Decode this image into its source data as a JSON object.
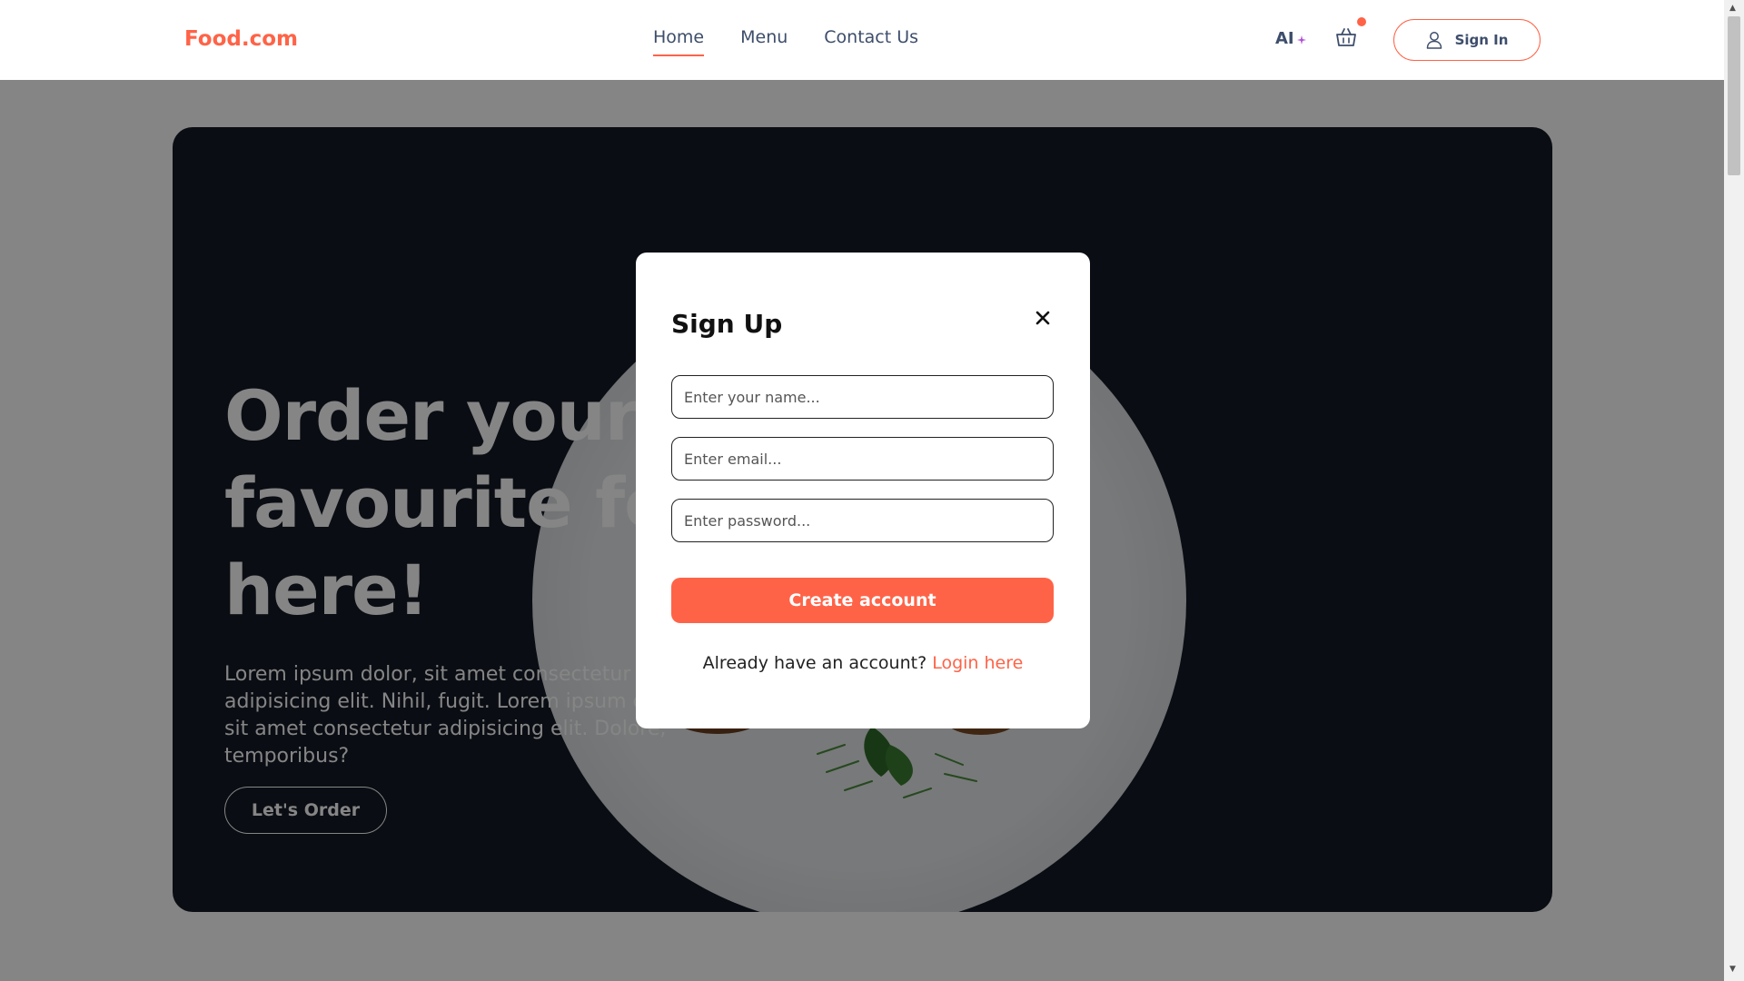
{
  "header": {
    "logo": "Food.com",
    "nav": [
      {
        "label": "Home",
        "active": true
      },
      {
        "label": "Menu",
        "active": false
      },
      {
        "label": "Contact Us",
        "active": false
      }
    ],
    "ai_label": "AI",
    "cart_icon": "basket-icon",
    "signin_label": "Sign In",
    "user_icon": "user-icon"
  },
  "hero": {
    "title": "Order your favourite food here!",
    "text": "Lorem ipsum dolor, sit amet consectetur adipisicing elit. Nihil, fugit. Lorem ipsum dolor, sit amet consectetur adipisicing elit. Dolore, temporibus?",
    "cta": "Let's Order"
  },
  "modal": {
    "title": "Sign Up",
    "close_icon": "close-icon",
    "name_placeholder": "Enter your name...",
    "email_placeholder": "Enter email...",
    "password_placeholder": "Enter password...",
    "submit_label": "Create account",
    "login_prompt": "Already have an account?",
    "login_link": "Login here"
  },
  "colors": {
    "accent": "#ff6347",
    "nav_text": "#3d4d6b",
    "hero_bg": "#141a26",
    "overlay": "rgba(0,0,0,0.48)"
  }
}
